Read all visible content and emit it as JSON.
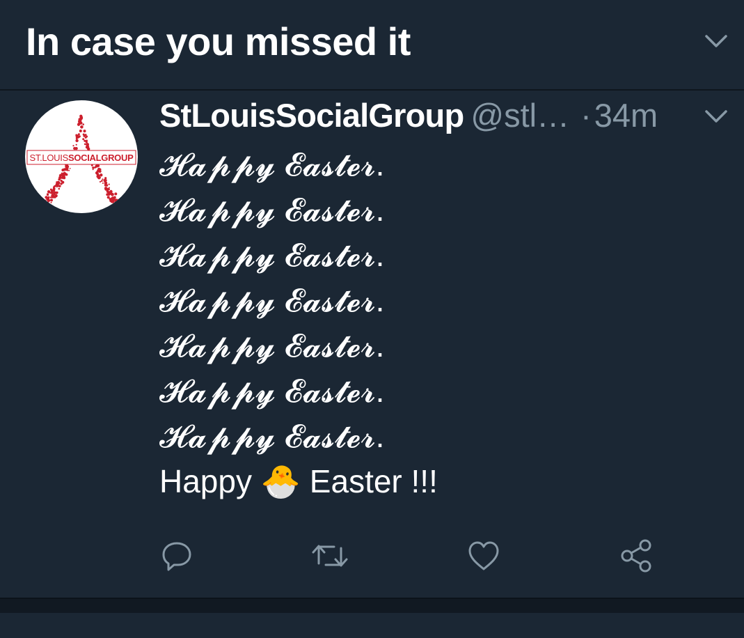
{
  "header": {
    "title": "In case you missed it"
  },
  "tweet": {
    "author_name": "StLouisSocialGroup",
    "handle": "@stl…",
    "separator": "·",
    "timestamp": "34m",
    "avatar": {
      "logo_text": "ST.LOUIS SOCIALGROUP",
      "brand_color": "#cc1f2d"
    },
    "body_lines": [
      "𝓗𝓪𝓹𝓹𝔂 𝓔𝓪𝓼𝓽𝓮𝓻.",
      "𝓗𝓪𝓹𝓹𝔂 𝓔𝓪𝓼𝓽𝓮𝓻.",
      "𝓗𝓪𝓹𝓹𝔂 𝓔𝓪𝓼𝓽𝓮𝓻.",
      "𝓗𝓪𝓹𝓹𝔂 𝓔𝓪𝓼𝓽𝓮𝓻.",
      "𝓗𝓪𝓹𝓹𝔂 𝓔𝓪𝓼𝓽𝓮𝓻.",
      "𝓗𝓪𝓹𝓹𝔂 𝓔𝓪𝓼𝓽𝓮𝓻.",
      "𝓗𝓪𝓹𝓹𝔂 𝓔𝓪𝓼𝓽𝓮𝓻.",
      "Happy 🐣 Easter !!!"
    ],
    "actions": [
      {
        "name": "reply",
        "icon": "reply-icon"
      },
      {
        "name": "retweet",
        "icon": "retweet-icon"
      },
      {
        "name": "like",
        "icon": "heart-icon"
      },
      {
        "name": "share",
        "icon": "share-icon"
      }
    ]
  },
  "colors": {
    "background": "#1b2734",
    "text_primary": "#ffffff",
    "text_secondary": "#8899a6",
    "divider": "#0f161e"
  }
}
